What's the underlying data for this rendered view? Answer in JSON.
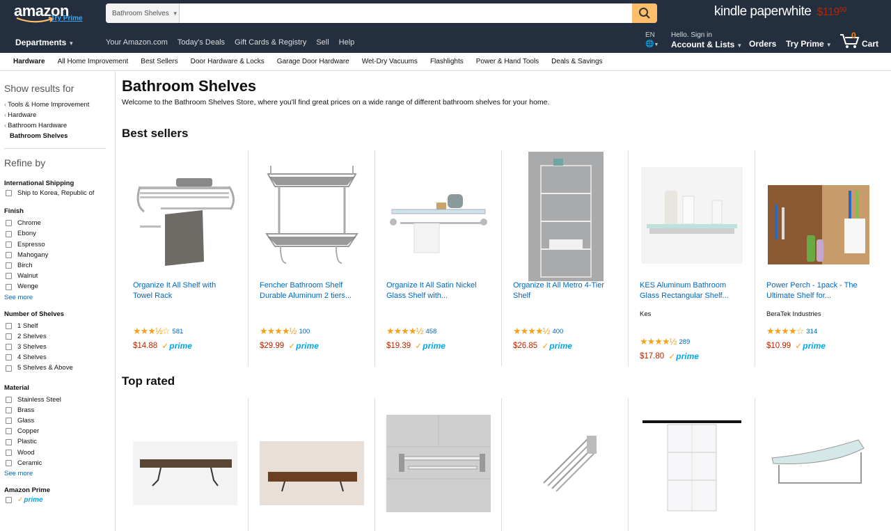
{
  "header": {
    "logo_text": "amazon",
    "logo_prime": "Try Prime",
    "search_category": "Bathroom Shelves",
    "search_placeholder": "",
    "promo_word": "kindle paperwhite",
    "promo_price_main": "$119",
    "promo_price_cents": "99",
    "departments_label": "Departments",
    "nav_links": [
      "Your Amazon.com",
      "Today's Deals",
      "Gift Cards & Registry",
      "Sell",
      "Help"
    ],
    "lang": "EN",
    "greeting": "Hello. Sign in",
    "account_label": "Account & Lists",
    "orders_label": "Orders",
    "try_prime_label": "Try Prime",
    "cart_count": "0",
    "cart_label": "Cart"
  },
  "subnav": [
    "Hardware",
    "All Home Improvement",
    "Best Sellers",
    "Door Hardware & Locks",
    "Garage Door Hardware",
    "Wet-Dry Vacuums",
    "Flashlights",
    "Power & Hand Tools",
    "Deals & Savings"
  ],
  "sidebar": {
    "show_results_for": "Show results for",
    "breadcrumbs": [
      "Tools & Home Improvement",
      "Hardware",
      "Bathroom Hardware"
    ],
    "current": "Bathroom Shelves",
    "refine_by": "Refine by",
    "intl_shipping_title": "International Shipping",
    "intl_shipping_option": "Ship to Korea, Republic of",
    "finish_title": "Finish",
    "finish_options": [
      "Chrome",
      "Ebony",
      "Espresso",
      "Mahogany",
      "Birch",
      "Walnut",
      "Wenge"
    ],
    "see_more": "See more",
    "shelves_title": "Number of Shelves",
    "shelves_options": [
      "1 Shelf",
      "2 Shelves",
      "3 Shelves",
      "4 Shelves",
      "5 Shelves & Above"
    ],
    "material_title": "Material",
    "material_options": [
      "Stainless Steel",
      "Brass",
      "Glass",
      "Copper",
      "Plastic",
      "Wood",
      "Ceramic"
    ],
    "amazon_prime_title": "Amazon Prime",
    "prime_label": "prime"
  },
  "main": {
    "title": "Bathroom Shelves",
    "description": "Welcome to the Bathroom Shelves Store, where you'll find great prices on a wide range of different bathroom shelves for your home.",
    "best_sellers_label": "Best sellers",
    "top_rated_label": "Top rated",
    "prime_label": "prime",
    "best_sellers": [
      {
        "title_1": "Organize It All Shelf with",
        "title_2": "Towel Rack",
        "brand": "",
        "stars": 3.5,
        "reviews": "581",
        "price": "$14.88"
      },
      {
        "title_1": "Fencher Bathroom Shelf",
        "title_2": "Durable Aluminum 2 tiers...",
        "brand": "",
        "stars": 4.5,
        "reviews": "100",
        "price": "$29.99"
      },
      {
        "title_1": "Organize It All Satin Nickel",
        "title_2": "Glass Shelf with...",
        "brand": "",
        "stars": 4.5,
        "reviews": "458",
        "price": "$19.39"
      },
      {
        "title_1": "Organize It All Metro 4-Tier",
        "title_2": "Shelf",
        "brand": "",
        "stars": 4.5,
        "reviews": "400",
        "price": "$26.85"
      },
      {
        "title_1": "KES Aluminum Bathroom",
        "title_2": "Glass Rectangular Shelf...",
        "brand": "Kes",
        "stars": 4.5,
        "reviews": "289",
        "price": "$17.80"
      },
      {
        "title_1": "Power Perch - 1pack - The",
        "title_2": "Ultimate Shelf for...",
        "brand": "BeraTek Industries",
        "stars": 4,
        "reviews": "314",
        "price": "$10.99"
      }
    ]
  }
}
